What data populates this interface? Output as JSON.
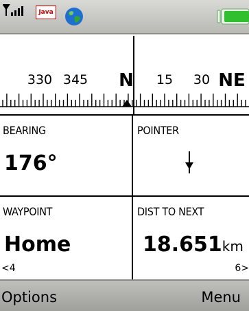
{
  "status_bar": {
    "java_badge": "Java",
    "icons": [
      "signal-icon",
      "java-icon",
      "globe-icon",
      "battery-icon"
    ]
  },
  "compass": {
    "labels": [
      {
        "text": "330",
        "kind": "minor"
      },
      {
        "text": "345",
        "kind": "minor"
      },
      {
        "text": "N",
        "kind": "cardinal"
      },
      {
        "text": "15",
        "kind": "minor"
      },
      {
        "text": "30",
        "kind": "minor"
      },
      {
        "text": "NE",
        "kind": "cardinal"
      }
    ]
  },
  "panels": {
    "bearing": {
      "title": "BEARING",
      "value": "176°"
    },
    "pointer": {
      "title": "POINTER"
    },
    "waypoint": {
      "title": "WAYPOINT",
      "value": "Home"
    },
    "dist": {
      "title": "DIST TO NEXT",
      "value": "18.651",
      "unit": "km"
    }
  },
  "nav": {
    "prev": "<4",
    "next": "6>"
  },
  "softkeys": {
    "left": "Options",
    "right": "Menu"
  },
  "colors": {
    "battery": "#2fbf2f",
    "java": "#cc0000",
    "bar": "#b9bab4"
  }
}
